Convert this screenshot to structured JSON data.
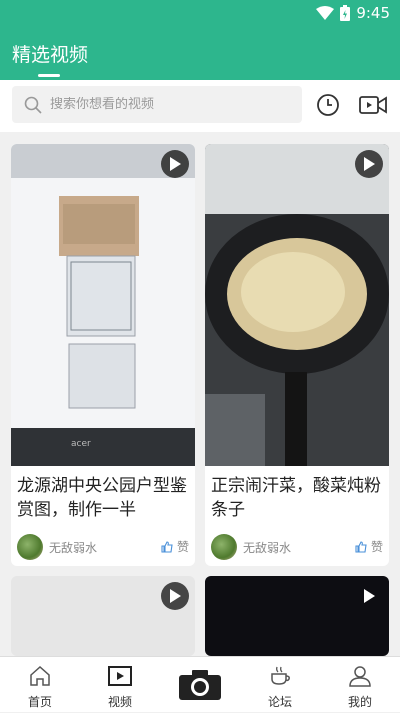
{
  "status": {
    "time": "9:45"
  },
  "header": {
    "title": "精选视频"
  },
  "search": {
    "placeholder": "搜索你想看的视频"
  },
  "cards": [
    {
      "title": "龙源湖中央公园户型鉴赏图，制作一半",
      "author": "无敌弱水",
      "like_label": "赞"
    },
    {
      "title": "正宗闹汗菜，酸菜炖粉条子",
      "author": "无敌弱水",
      "like_label": "赞"
    }
  ],
  "tabbar": {
    "items": [
      {
        "label": "首页",
        "icon": "home-icon"
      },
      {
        "label": "视频",
        "icon": "video-icon"
      },
      {
        "label": "",
        "icon": "camera-icon"
      },
      {
        "label": "论坛",
        "icon": "cup-icon"
      },
      {
        "label": "我的",
        "icon": "person-icon"
      }
    ]
  },
  "colors": {
    "brand": "#2db68d"
  }
}
